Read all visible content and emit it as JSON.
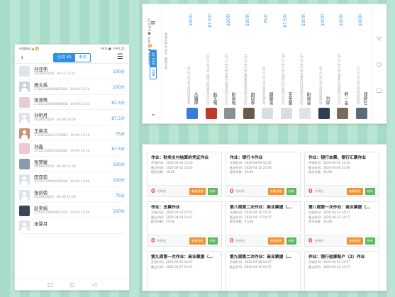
{
  "phone": {
    "status": {
      "left": "中国移动 ▲ 📶",
      "right": "94% ■ 下午4:21"
    },
    "tabs": [
      "已交 41",
      "未交"
    ],
    "list": [
      {
        "name": "孙亚伟",
        "sid": "2019925020",
        "date": "04-12 12:21",
        "score": "100分"
      },
      {
        "name": "杨文禹",
        "sid": "37142120040815469",
        "date": "04-09 11:14",
        "score": "100分"
      },
      {
        "name": "张淑珠",
        "sid": "37142120040908048",
        "date": "04-09 11:43",
        "score": "62.5分"
      },
      {
        "name": "孙明月",
        "sid": "2019925020",
        "date": "04-09 16:59",
        "score": "87.5分"
      },
      {
        "name": "王英洁",
        "sid": "37142120012132983",
        "date": "04-09 13:15",
        "score": "75分"
      },
      {
        "name": "孙鑫",
        "sid": "37142120032226464",
        "date": "04-09 13:10",
        "score": "87.5分"
      },
      {
        "name": "张梦媛",
        "sid": "2019925020",
        "date": "04-09 13:38",
        "score": "100分"
      },
      {
        "name": "田亚茹",
        "sid": "37142120040229666",
        "date": "04-09 14:40",
        "score": "100分"
      },
      {
        "name": "张凯菊",
        "sid": "2019925020",
        "date": "04-09 11:00",
        "score": "75分"
      },
      {
        "name": "赵美娟",
        "sid": "37142120040917525",
        "date": "04-09 12:46",
        "score": "100分"
      },
      {
        "name": "张慧月",
        "sid": "",
        "date": "",
        "score": ""
      }
    ],
    "nav": [
      "□",
      "○",
      "◁"
    ]
  },
  "landscape": {
    "status": "中国移动 ▲ 📶  94% ■ 下午4:22",
    "title": "第九周第二次作业:商业票据",
    "tabs": [
      "已交 37",
      "未交"
    ],
    "cols": [
      {
        "name": "赵鹏宇",
        "sid": "2019925020",
        "date": "04-19 12:18",
        "score": "100分"
      },
      {
        "name": "陈玉坤",
        "sid": "37142120039521431",
        "date": "04-19 11:55",
        "score": "87.5分"
      },
      {
        "name": "陈晓琪",
        "sid": "37142120040815469",
        "date": "04-19 11:45",
        "score": "100分"
      },
      {
        "name": "金四嵘",
        "sid": "37142120040908048",
        "date": "04-19 11:43",
        "score": "100分"
      },
      {
        "name": "张雅静",
        "sid": "2019925020",
        "date": "04-19 11:46",
        "score": "75分"
      },
      {
        "name": "黄英玉",
        "sid": "37142120012132983",
        "date": "04-19 11:38",
        "score": "87.5分"
      },
      {
        "name": "乔佩琪",
        "sid": "37142120032226464",
        "date": "04-19 11:37",
        "score": "100分"
      },
      {
        "name": "刘钰",
        "sid": "2019925020",
        "date": "04-19 11:36",
        "score": "100分"
      },
      {
        "name": "李一涵",
        "sid": "37142120040229666",
        "date": "04-19 11:36",
        "score": "100分"
      },
      {
        "name": "马骏航",
        "sid": "2019925020",
        "date": "04-19 11:35",
        "score": "100分"
      }
    ],
    "nav": [
      "▽",
      "○",
      "□"
    ]
  },
  "cards": [
    {
      "title": "作业：财务支付结算的凭证作业",
      "start": "开始时间：2020-04-10 13:50",
      "end": "截止时间：2020-04-12 15:02",
      "count": "提交份数：41/48",
      "unsub": "0",
      "unit": "份待批",
      "b1": "查看批改",
      "b2": "结束"
    },
    {
      "title": "作业：银行卡作业",
      "start": "开始时间：2020-04-09 11:00",
      "end": "截止时间：2020-04-10 23:59",
      "count": "提交份数：41/48",
      "unsub": "0",
      "unit": "份待批",
      "b1": "查看批改",
      "b2": "结束"
    },
    {
      "title": "作业：银行本票、银行汇票作业",
      "start": "开始时间：2020-04-05 13:50",
      "end": "截止时间：2020-04-06 15:06",
      "count": "提交份数：41/48",
      "unsub": "0",
      "unit": "份待批",
      "b1": "查看批改",
      "b2": "结束"
    },
    {
      "title": "作业：支票作业",
      "start": "开始时间：2020-04-03 14:57",
      "end": "截止时间：2020-04-04 14:57",
      "count": "提交份数：41/48",
      "unsub": "0",
      "unit": "份待批",
      "b1": "查看批改",
      "b2": "结束"
    },
    {
      "title": "第八周第二次作业：商业票据（…",
      "start": "开始时间：2020-04-16 14:57",
      "end": "截止时间：2020-04-17 14:57",
      "count": "提交份数：41/48",
      "unsub": "0",
      "unit": "份待批",
      "b1": "查看批改",
      "b2": "结束"
    },
    {
      "title": "第八周第一次作业：商业票据（…",
      "start": "开始时间：2020-04-14 14:57",
      "end": "截止时间：2020-04-15 14:57",
      "count": "提交份数：41/48",
      "unsub": "0",
      "unit": "份待批",
      "b1": "查看批改",
      "b2": "结束"
    },
    {
      "title": "第九周第一次作业：商业票据（…",
      "start": "开始时间：2020-04-26 14:57",
      "end": "截止时间：2020-04-27 14:57",
      "count": "",
      "unsub": "",
      "unit": "",
      "b1": "",
      "b2": ""
    },
    {
      "title": "第九周第二次作业：商业票据（…",
      "start": "开始时间：2020-04-28 14:57",
      "end": "截止时间：2020-04-30 14:57",
      "count": "",
      "unsub": "",
      "unit": "",
      "b1": "",
      "b2": ""
    },
    {
      "title": "作业：银行结算账户（2）作业",
      "start": "开始时间：2020-04-10 14:57",
      "end": "截止时间：2020-04-12 14:57",
      "count": "",
      "unsub": "",
      "unit": "",
      "b1": "",
      "b2": ""
    }
  ]
}
